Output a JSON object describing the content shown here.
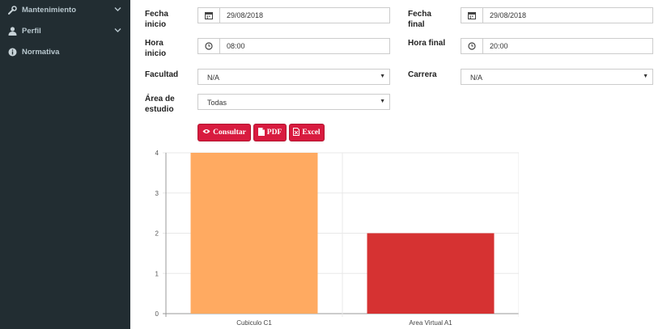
{
  "sidebar": {
    "items": [
      {
        "label": "Mantenimiento",
        "icon": "wrench-icon",
        "chevron": true
      },
      {
        "label": "Perfil",
        "icon": "user-icon",
        "chevron": true
      },
      {
        "label": "Normativa",
        "icon": "info-icon",
        "chevron": false
      }
    ]
  },
  "form": {
    "fecha_inicio": {
      "label_line1": "Fecha",
      "label_line2": "inicio",
      "value": "29/08/2018"
    },
    "fecha_final": {
      "label_line1": "Fecha",
      "label_line2": "final",
      "value": "29/08/2018"
    },
    "hora_inicio": {
      "label_line1": "Hora",
      "label_line2": "inicio",
      "value": "08:00"
    },
    "hora_final": {
      "label": "Hora final",
      "value": "20:00"
    },
    "facultad": {
      "label": "Facultad",
      "value": "N/A"
    },
    "carrera": {
      "label": "Carrera",
      "value": "N/A"
    },
    "area": {
      "label_line1": "Área de",
      "label_line2": "estudio",
      "value": "Todas"
    }
  },
  "buttons": {
    "consultar": "Consultar",
    "pdf": "PDF",
    "excel": "Excel"
  },
  "colors": {
    "sidebar_bg": "#222d32",
    "button": "#d81b3f",
    "bar1": "#ffaa61",
    "bar2": "#d63232"
  },
  "chart_data": {
    "type": "bar",
    "categories": [
      "Cubiculo C1",
      "Area Virtual A1"
    ],
    "values": [
      4,
      2
    ],
    "colors": [
      "#ffaa61",
      "#d63232"
    ],
    "yticks": [
      0,
      1,
      2,
      3,
      4
    ],
    "ylim": [
      0,
      4
    ],
    "grid": true
  }
}
